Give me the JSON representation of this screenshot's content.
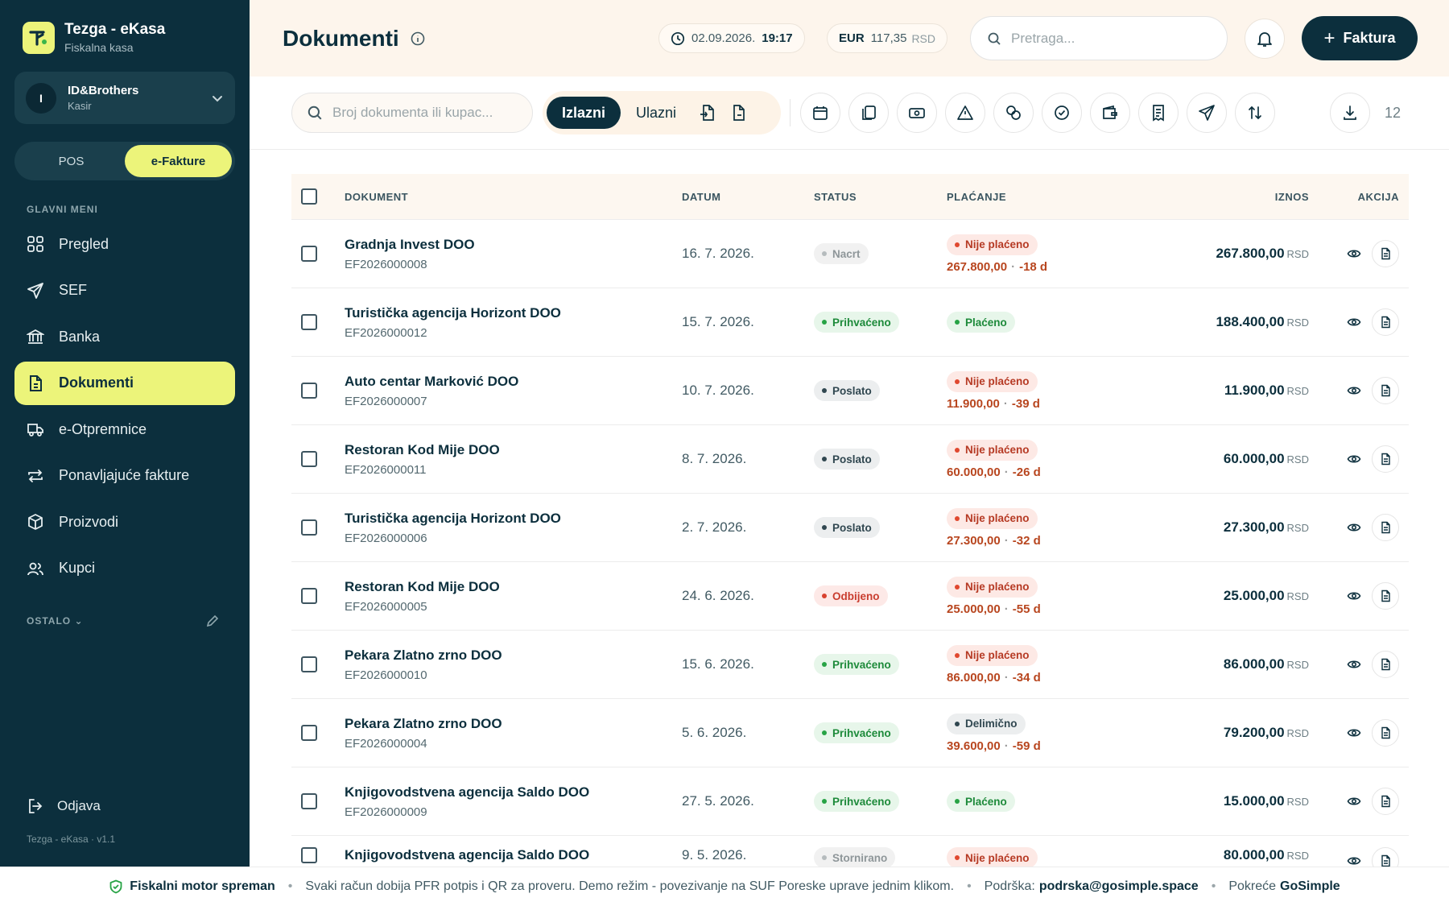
{
  "brand": {
    "name": "Tezga - eKasa",
    "subtitle": "Fiskalna kasa"
  },
  "account": {
    "initial": "I",
    "name": "ID&Brothers",
    "role": "Kasir"
  },
  "mode_toggle": {
    "pos": "POS",
    "efakture": "e-Fakture",
    "active": "e-Fakture"
  },
  "sidebar": {
    "section_label": "GLAVNI MENI",
    "items": [
      {
        "label": "Pregled",
        "icon": "grid-icon"
      },
      {
        "label": "SEF",
        "icon": "send-icon"
      },
      {
        "label": "Banka",
        "icon": "bank-icon"
      },
      {
        "label": "Dokumenti",
        "icon": "document-icon",
        "active": true
      },
      {
        "label": "e-Otpremnice",
        "icon": "truck-icon"
      },
      {
        "label": "Ponavljajuće fakture",
        "icon": "repeat-icon"
      },
      {
        "label": "Proizvodi",
        "icon": "box-icon"
      },
      {
        "label": "Kupci",
        "icon": "users-icon"
      }
    ],
    "other_label": "OSTALO",
    "logout_label": "Odjava",
    "version": "Tezga - eKasa · v1.1"
  },
  "topbar": {
    "title": "Dokumenti",
    "date": "02.09.2026.",
    "time": "19:17",
    "currency": "EUR",
    "rate": "117,35",
    "rate_currency": "RSD",
    "search_placeholder": "Pretraga...",
    "new_button": "Faktura"
  },
  "filters": {
    "search_placeholder": "Broj dokumenta ili kupac...",
    "outgoing": "Izlazni",
    "incoming": "Ulazni",
    "active_direction": "Izlazni",
    "count": "12"
  },
  "table": {
    "headers": {
      "document": "DOKUMENT",
      "date": "DATUM",
      "status": "STATUS",
      "payment": "PLAĆANJE",
      "amount": "IZNOS",
      "action": "AKCIJA"
    },
    "rows": [
      {
        "customer": "Gradnja Invest DOO",
        "number": "EF2026000008",
        "date": "16. 7. 2026.",
        "status": "Nacrt",
        "status_kind": "nacrt",
        "payment": "Nije plaćeno",
        "payment_kind": "nije",
        "due_amount": "267.800,00",
        "due_days": "-18 d",
        "amount": "267.800,00",
        "currency": "RSD"
      },
      {
        "customer": "Turistička agencija Horizont DOO",
        "number": "EF2026000012",
        "date": "15. 7. 2026.",
        "status": "Prihvaćeno",
        "status_kind": "prihv",
        "payment": "Plaćeno",
        "payment_kind": "plac",
        "due_amount": "",
        "due_days": "",
        "amount": "188.400,00",
        "currency": "RSD"
      },
      {
        "customer": "Auto centar Marković DOO",
        "number": "EF2026000007",
        "date": "10. 7. 2026.",
        "status": "Poslato",
        "status_kind": "poslato",
        "payment": "Nije plaćeno",
        "payment_kind": "nije",
        "due_amount": "11.900,00",
        "due_days": "-39 d",
        "amount": "11.900,00",
        "currency": "RSD"
      },
      {
        "customer": "Restoran Kod Mije DOO",
        "number": "EF2026000011",
        "date": "8. 7. 2026.",
        "status": "Poslato",
        "status_kind": "poslato",
        "payment": "Nije plaćeno",
        "payment_kind": "nije",
        "due_amount": "60.000,00",
        "due_days": "-26 d",
        "amount": "60.000,00",
        "currency": "RSD"
      },
      {
        "customer": "Turistička agencija Horizont DOO",
        "number": "EF2026000006",
        "date": "2. 7. 2026.",
        "status": "Poslato",
        "status_kind": "poslato",
        "payment": "Nije plaćeno",
        "payment_kind": "nije",
        "due_amount": "27.300,00",
        "due_days": "-32 d",
        "amount": "27.300,00",
        "currency": "RSD"
      },
      {
        "customer": "Restoran Kod Mije DOO",
        "number": "EF2026000005",
        "date": "24. 6. 2026.",
        "status": "Odbijeno",
        "status_kind": "odbij",
        "payment": "Nije plaćeno",
        "payment_kind": "nije",
        "due_amount": "25.000,00",
        "due_days": "-55 d",
        "amount": "25.000,00",
        "currency": "RSD"
      },
      {
        "customer": "Pekara Zlatno zrno DOO",
        "number": "EF2026000010",
        "date": "15. 6. 2026.",
        "status": "Prihvaćeno",
        "status_kind": "prihv",
        "payment": "Nije plaćeno",
        "payment_kind": "nije",
        "due_amount": "86.000,00",
        "due_days": "-34 d",
        "amount": "86.000,00",
        "currency": "RSD"
      },
      {
        "customer": "Pekara Zlatno zrno DOO",
        "number": "EF2026000004",
        "date": "5. 6. 2026.",
        "status": "Prihvaćeno",
        "status_kind": "prihv",
        "payment": "Delimično",
        "payment_kind": "del",
        "due_amount": "39.600,00",
        "due_days": "-59 d",
        "amount": "79.200,00",
        "currency": "RSD"
      },
      {
        "customer": "Knjigovodstvena agencija Saldo DOO",
        "number": "EF2026000009",
        "date": "27. 5. 2026.",
        "status": "Prihvaćeno",
        "status_kind": "prihv",
        "payment": "Plaćeno",
        "payment_kind": "plac",
        "due_amount": "",
        "due_days": "",
        "amount": "15.000,00",
        "currency": "RSD"
      },
      {
        "customer": "Knjigovodstvena agencija Saldo DOO",
        "number": "",
        "date": "9. 5. 2026.",
        "status": "Stornirano",
        "status_kind": "storn",
        "payment": "Nije plaćeno",
        "payment_kind": "nije",
        "due_amount": "",
        "due_days": "",
        "amount": "80.000,00",
        "currency": "RSD"
      }
    ]
  },
  "footer": {
    "engine": "Fiskalni motor spreman",
    "info": "Svaki račun dobija PFR potpis i QR za proveru. Demo režim - povezivanje na SUF Poreske uprave jednim klikom.",
    "support_label": "Podrška:",
    "support_email": "podrska@gosimple.space",
    "powered_label": "Pokreće",
    "powered_by": "GoSimple"
  },
  "colors": {
    "sidebar": "#0c2f3d",
    "accent": "#ecf47a",
    "topbar": "#fdf5ec"
  }
}
